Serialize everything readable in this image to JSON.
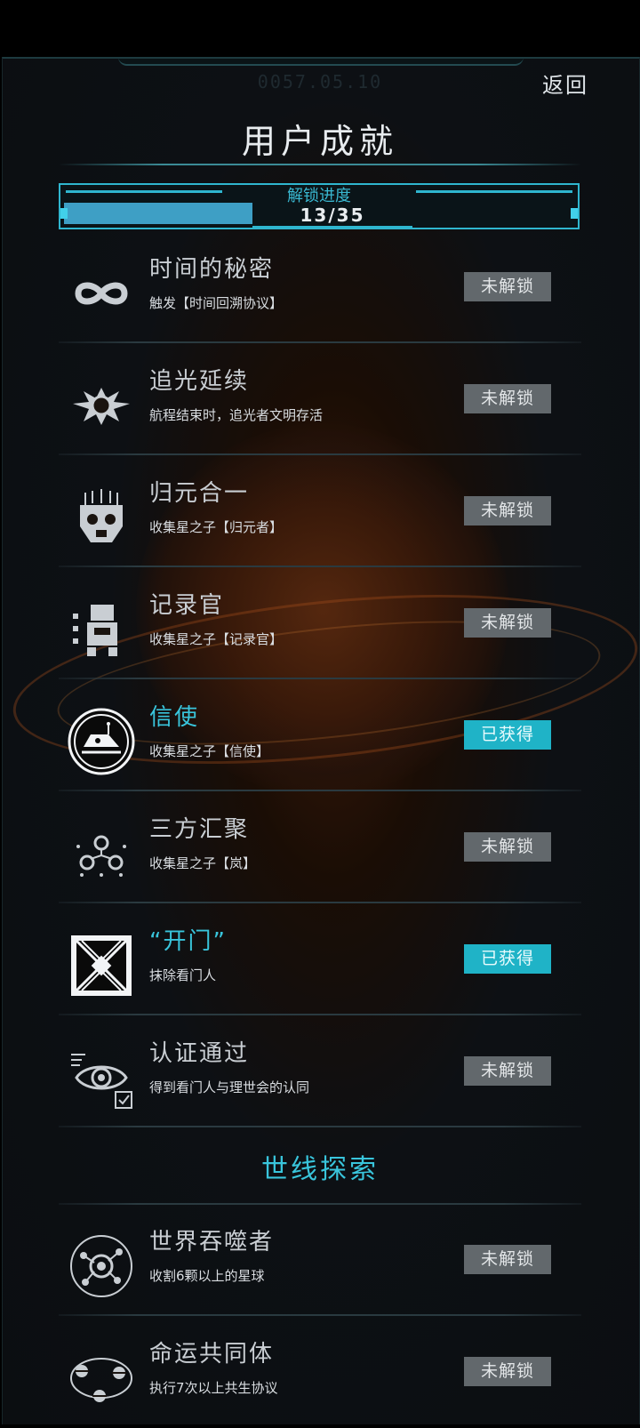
{
  "header": {
    "date": "0057.05.10",
    "back_label": "返回",
    "title": "用户成就"
  },
  "progress": {
    "label": "解锁进度",
    "count": "13/35",
    "fraction": 0.37
  },
  "achievements": [
    {
      "name": "时间的秘密",
      "desc": "触发【时间回溯协议】",
      "status": "未解锁",
      "icon": "infinity-icon",
      "unlocked": false
    },
    {
      "name": "追光延续",
      "desc": "航程结束时，追光者文明存活",
      "status": "未解锁",
      "icon": "winged-emblem-icon",
      "unlocked": false
    },
    {
      "name": "归元合一",
      "desc": "收集星之子【归元者】",
      "status": "未解锁",
      "icon": "mask-icon",
      "unlocked": false
    },
    {
      "name": "记录官",
      "desc": "收集星之子【记录官】",
      "status": "未解锁",
      "icon": "robot-icon",
      "unlocked": false
    },
    {
      "name": "信使",
      "desc": "收集星之子【信使】",
      "status": "已获得",
      "icon": "messenger-ship-icon",
      "unlocked": true
    },
    {
      "name": "三方汇聚",
      "desc": "收集星之子【岚】",
      "status": "未解锁",
      "icon": "constellation-icon",
      "unlocked": false
    },
    {
      "name": "“开门”",
      "desc": "抹除看门人",
      "status": "已获得",
      "icon": "portal-icon",
      "unlocked": true
    },
    {
      "name": "认证通过",
      "desc": "得到看门人与理世会的认同",
      "status": "未解锁",
      "icon": "eye-verify-icon",
      "unlocked": false
    }
  ],
  "section_title": "世线探索",
  "explore": [
    {
      "name": "世界吞噬者",
      "desc": "收割6颗以上的星球",
      "status": "未解锁",
      "icon": "planet-devourer-icon",
      "unlocked": false
    },
    {
      "name": "命运共同体",
      "desc": "执行7次以上共生协议",
      "status": "未解锁",
      "icon": "orbit-planets-icon",
      "unlocked": false
    }
  ]
}
